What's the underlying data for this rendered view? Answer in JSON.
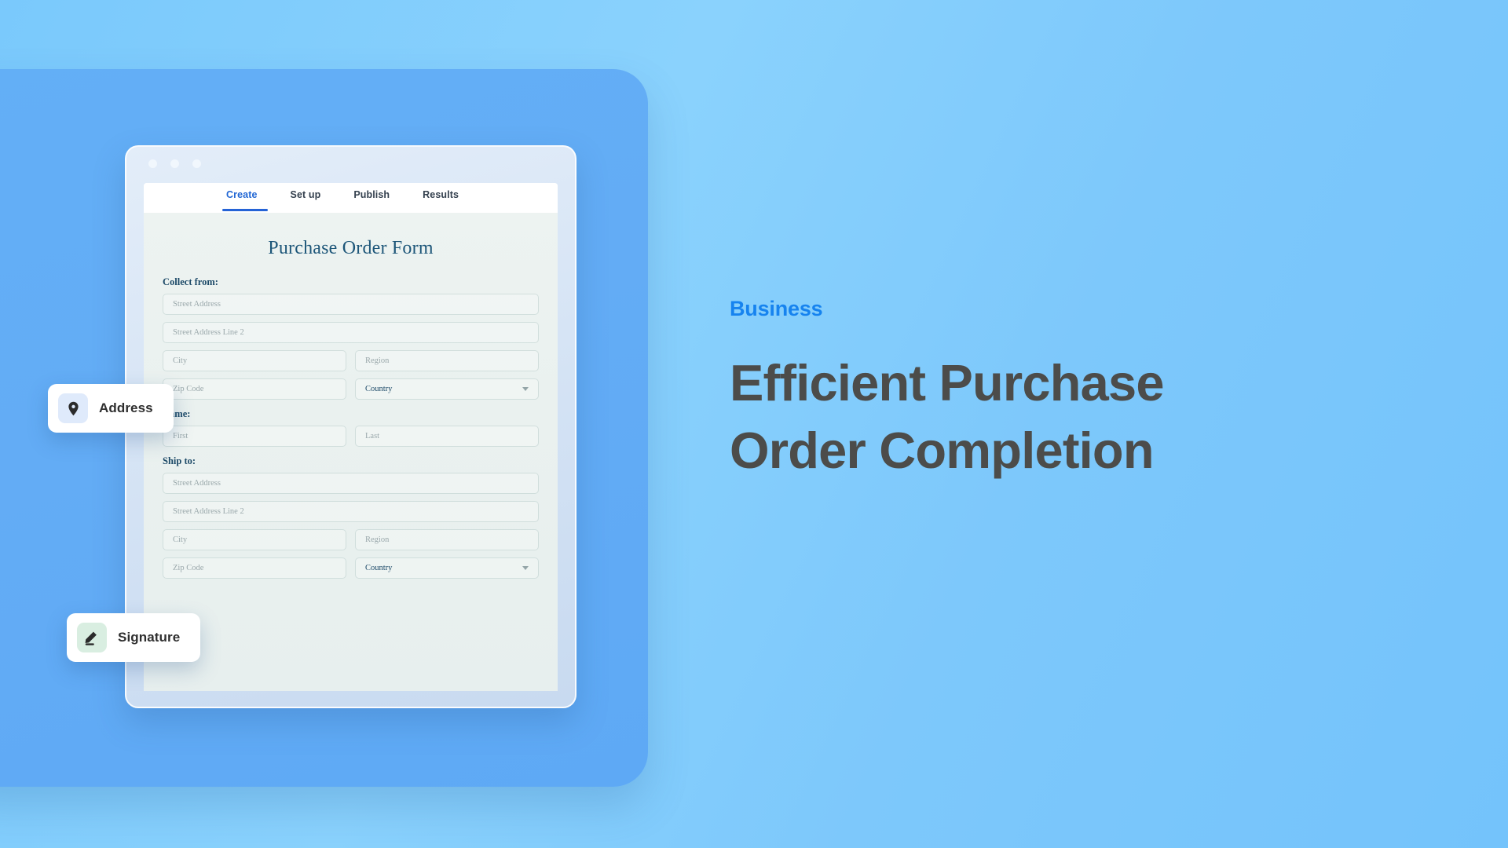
{
  "theme": {
    "background_gradient_from": "#7ac9fc",
    "background_gradient_to": "#74c3fb",
    "panel_blue": "#63acf5",
    "accent_blue": "#1683ef",
    "tab_active_blue": "#2267d4",
    "headline_gray": "#4c4c4a",
    "form_title_blue": "#1d5679",
    "form_background": "#eaf1ef"
  },
  "browser": {
    "traffic_lights": [
      "window-dot-close",
      "window-dot-minimize",
      "window-dot-maximize"
    ],
    "tabs": [
      {
        "label": "Create",
        "active": true
      },
      {
        "label": "Set up",
        "active": false
      },
      {
        "label": "Publish",
        "active": false
      },
      {
        "label": "Results",
        "active": false
      }
    ]
  },
  "form": {
    "title": "Purchase Order Form",
    "sections": [
      {
        "label": "Collect from:",
        "fields": [
          {
            "placeholder": "Street Address",
            "type": "text",
            "full": true
          },
          {
            "placeholder": "Street Address Line 2",
            "type": "text",
            "full": true
          },
          {
            "placeholder": "City",
            "type": "text",
            "full": false
          },
          {
            "placeholder": "Region",
            "type": "text",
            "full": false
          },
          {
            "placeholder": "Zip Code",
            "type": "text",
            "full": false
          },
          {
            "placeholder": "Country",
            "type": "select",
            "full": false
          }
        ]
      },
      {
        "label": "Name:",
        "fields": [
          {
            "placeholder": "First",
            "type": "text",
            "full": false
          },
          {
            "placeholder": "Last",
            "type": "text",
            "full": false
          }
        ]
      },
      {
        "label": "Ship to:",
        "fields": [
          {
            "placeholder": "Street Address",
            "type": "text",
            "full": true
          },
          {
            "placeholder": "Street Address Line 2",
            "type": "text",
            "full": true
          },
          {
            "placeholder": "City",
            "type": "text",
            "full": false
          },
          {
            "placeholder": "Region",
            "type": "text",
            "full": false
          },
          {
            "placeholder": "Zip Code",
            "type": "text",
            "full": false
          },
          {
            "placeholder": "Country",
            "type": "select",
            "full": false
          }
        ]
      }
    ]
  },
  "badges": [
    {
      "label": "Address",
      "icon": "map-pin-icon",
      "icon_background": "#dfeafb"
    },
    {
      "label": "Signature",
      "icon": "pencil-signature-icon",
      "icon_background": "#d9eee1"
    }
  ],
  "copy": {
    "eyebrow": "Business",
    "headline_line1": "Efficient Purchase",
    "headline_line2": "Order Completion"
  }
}
